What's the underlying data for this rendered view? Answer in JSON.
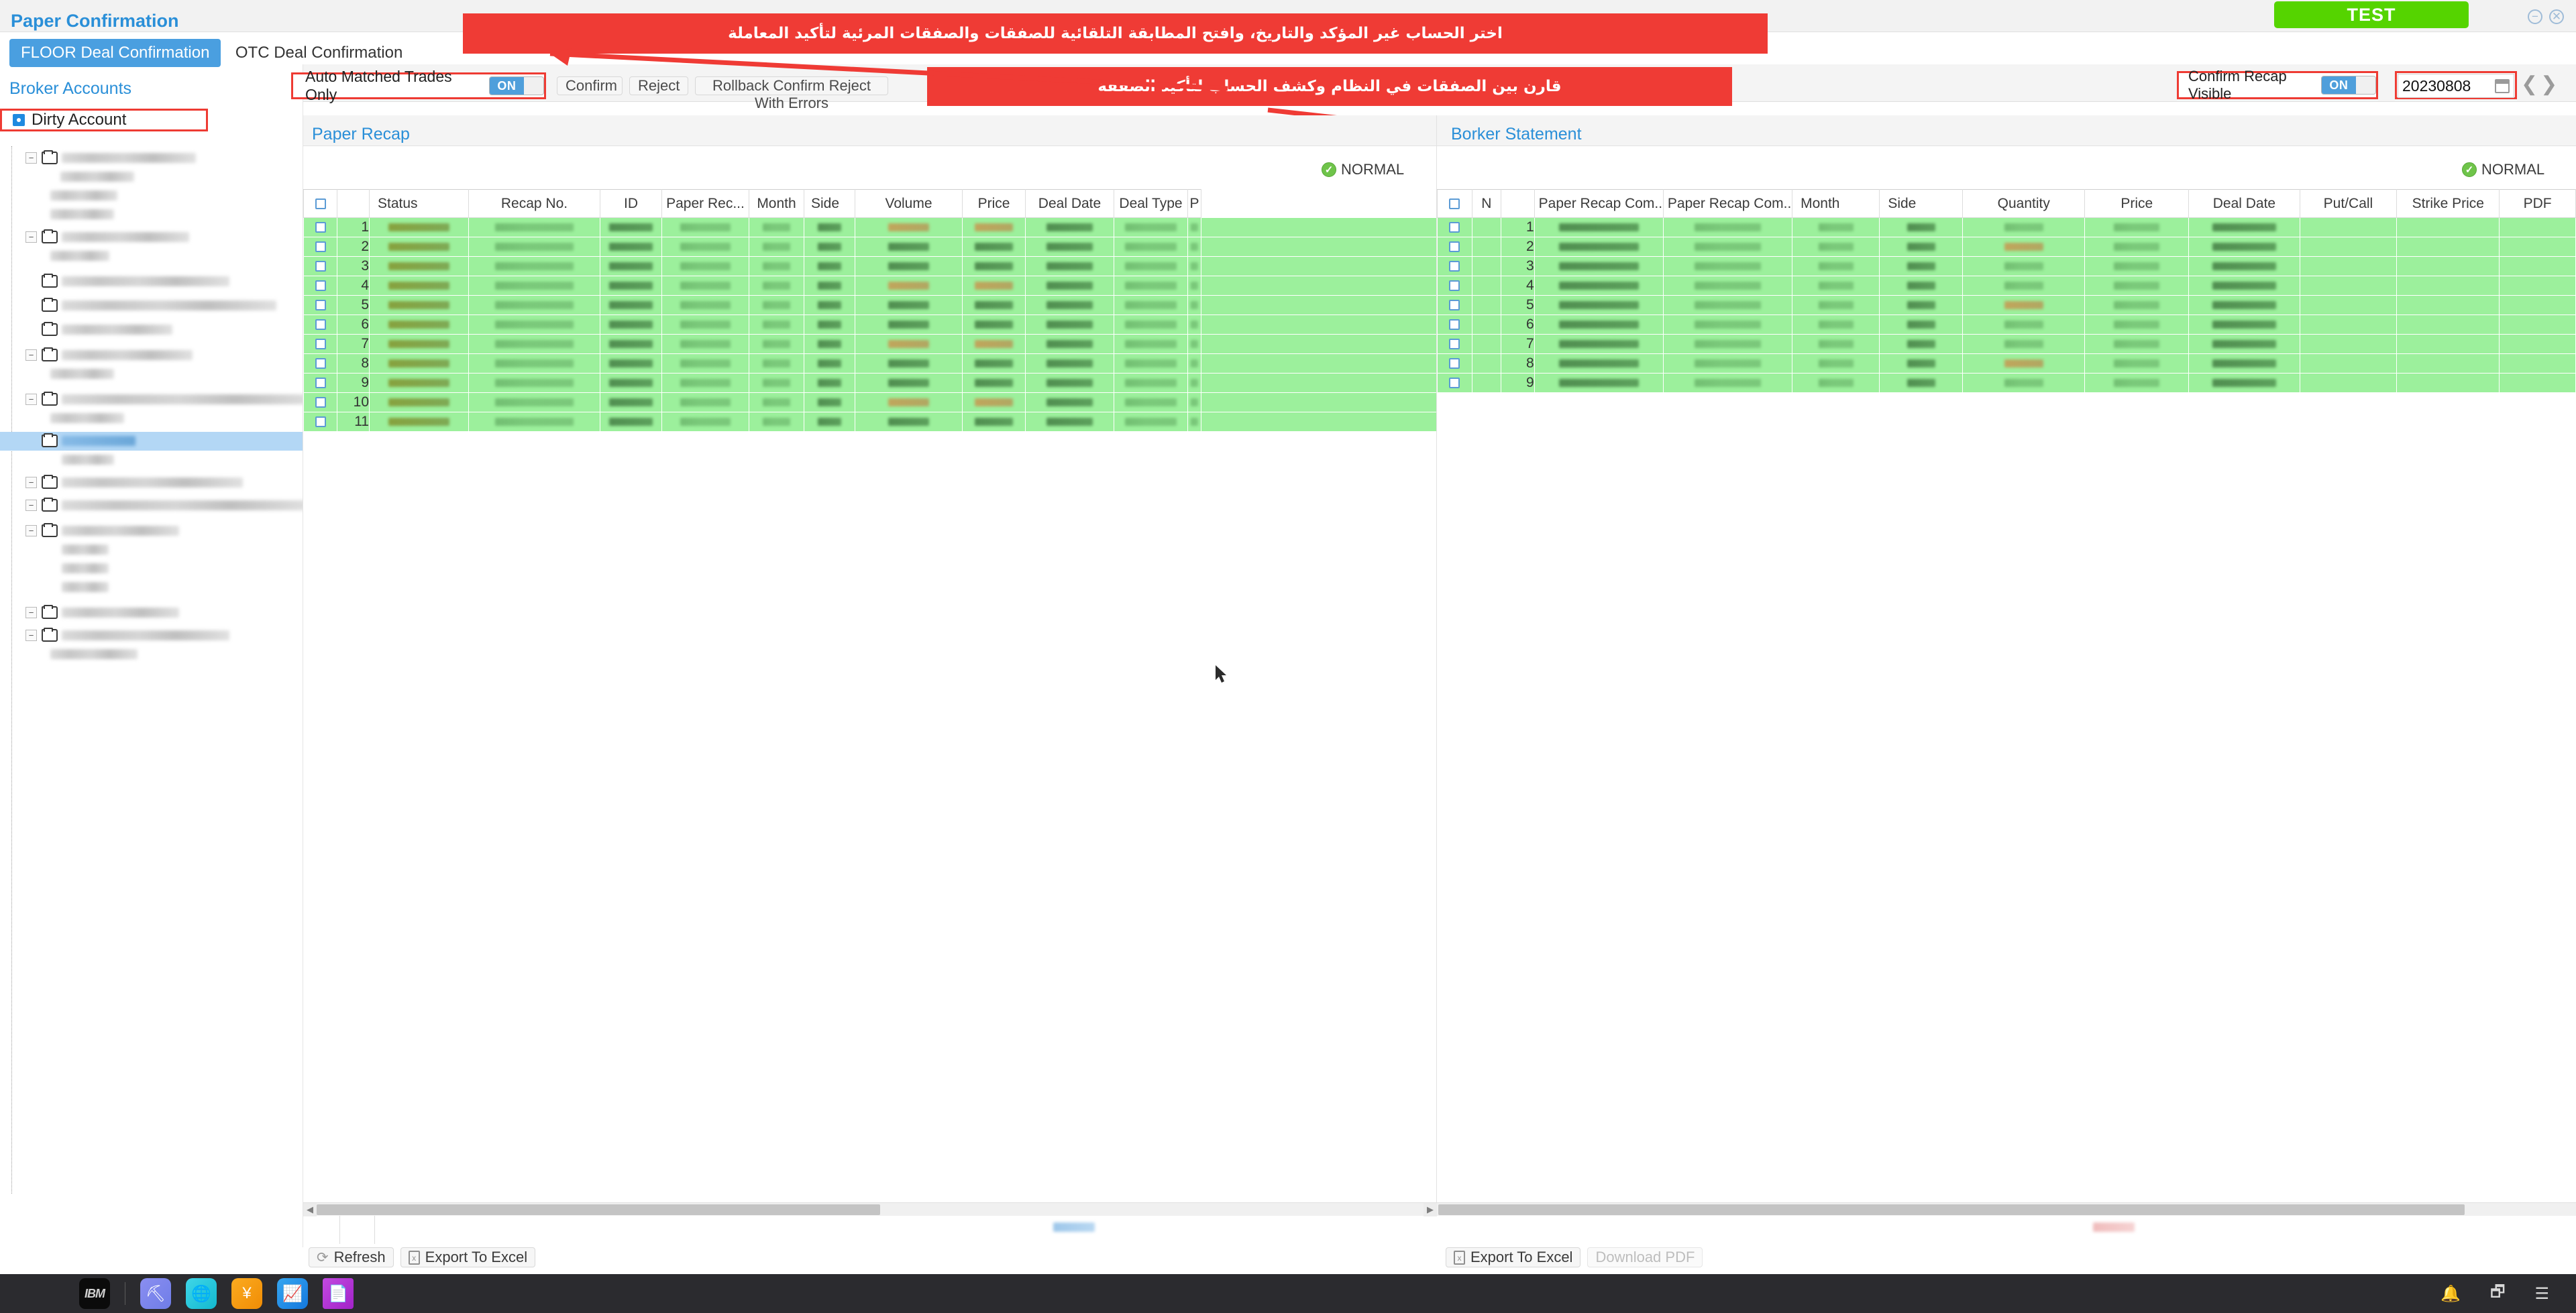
{
  "window": {
    "test_button": "TEST",
    "minimize_icon": "−",
    "close_icon": "✕"
  },
  "header": {
    "page_title": "Paper Confirmation",
    "tabs": [
      {
        "label": "FLOOR Deal Confirmation",
        "active": true
      },
      {
        "label": "OTC Deal Confirmation",
        "active": false
      }
    ],
    "sub_title": "Broker Accounts"
  },
  "sidebar": {
    "dirty_account_label": "Dirty Account",
    "dirty_account_checked": true
  },
  "toolbar": {
    "auto_matched_label": "Auto Matched Trades Only",
    "auto_matched_state": "ON",
    "confirm_label": "Confirm",
    "reject_label": "Reject",
    "rollback_label": "Rollback Confirm Reject With Errors",
    "confirm_recap_visible_label": "Confirm Recap Visible",
    "confirm_recap_visible_state": "ON",
    "date_value": "20230808",
    "date_prev_icon": "❮",
    "date_next_icon": "❯"
  },
  "annotations": {
    "banner_1": "اختر الحساب غير المؤكد والتاريخ، وافتح المطابقة التلقائية للصفقات والصفقات المرئية لتأكيد المعاملة",
    "banner_2": "قارن بين الصفقات في النظام وكشف الحساب لتأكيد الصفقة",
    "highlight_color": "#ef3b35"
  },
  "left_panel": {
    "title": "Paper Recap",
    "status_text": "NORMAL",
    "status_icon": "check-circle-icon",
    "columns": [
      "Status",
      "Recap No.",
      "ID",
      "Paper Rec...",
      "Month",
      "Side",
      "Volume",
      "Price",
      "Deal Date",
      "Deal Type",
      "P"
    ],
    "row_numbers": [
      "1",
      "2",
      "3",
      "4",
      "5",
      "6",
      "7",
      "8",
      "9",
      "10",
      "11"
    ],
    "footer": {
      "refresh_label": "Refresh",
      "export_label": "Export To Excel",
      "refresh_icon": "refresh-icon",
      "export_icon": "excel-icon"
    }
  },
  "right_panel": {
    "title": "Borker Statement",
    "status_text": "NORMAL",
    "status_icon": "check-circle-icon",
    "columns": [
      "N",
      "Paper Recap Com...",
      "Paper Recap Com...",
      "Month",
      "Side",
      "Quantity",
      "Price",
      "Deal Date",
      "Put/Call",
      "Strike Price",
      "PDF"
    ],
    "row_numbers": [
      "1",
      "2",
      "3",
      "4",
      "5",
      "6",
      "7",
      "8",
      "9"
    ],
    "footer": {
      "export_label": "Export To Excel",
      "download_pdf_label": "Download PDF",
      "export_icon": "excel-icon",
      "download_pdf_disabled": true
    }
  },
  "taskbar": {
    "items": [
      {
        "name": "ibm-logo",
        "glyph": "IBM"
      },
      {
        "name": "oil-rig-app",
        "glyph": "⛏",
        "color": "#7b82ea"
      },
      {
        "name": "globe-app",
        "glyph": "🌐",
        "color": "#18c8d8"
      },
      {
        "name": "yen-app",
        "glyph": "¥",
        "color": "#f5990d"
      },
      {
        "name": "chart-app",
        "glyph": "📈",
        "color": "#1e90e8"
      },
      {
        "name": "document-app",
        "glyph": "📄",
        "color": "#b636d6"
      }
    ],
    "tray": [
      {
        "name": "bell-icon",
        "glyph": "🔔"
      },
      {
        "name": "window-icon",
        "glyph": "🗗"
      },
      {
        "name": "menu-icon",
        "glyph": "☰"
      }
    ]
  }
}
